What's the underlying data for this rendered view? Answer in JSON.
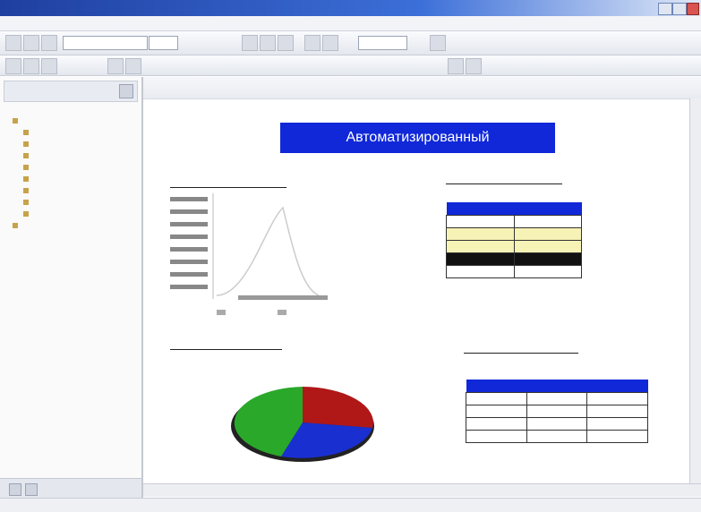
{
  "window": {
    "title": "",
    "controls": {
      "minimize": "minimize-icon",
      "maximize": "maximize-icon",
      "close": "close-icon"
    }
  },
  "menu": {
    "items": []
  },
  "toolbar": {
    "font_field": "",
    "size_field": "",
    "zoom_field": ""
  },
  "left_panel": {
    "header_label": "",
    "tree_items": [
      "",
      "",
      "",
      "",
      "",
      "",
      "",
      "",
      "",
      ""
    ]
  },
  "report": {
    "banner_title": "Автоматизированный",
    "line_chart_title": "",
    "pie_chart_title": "",
    "top_table_title": "",
    "bottom_table_title": "",
    "pie_labels": {
      "top": "",
      "right_upper": "",
      "right_lower": "",
      "left": "",
      "bottom": ""
    }
  },
  "status": {
    "text": ""
  },
  "colors": {
    "banner": "#1028d8",
    "pie_red": "#b01818",
    "pie_green": "#2aa82a",
    "pie_blue": "#1a2fd0",
    "table_header": "#1028d8",
    "table_highlight": "#f7f2b5"
  }
}
